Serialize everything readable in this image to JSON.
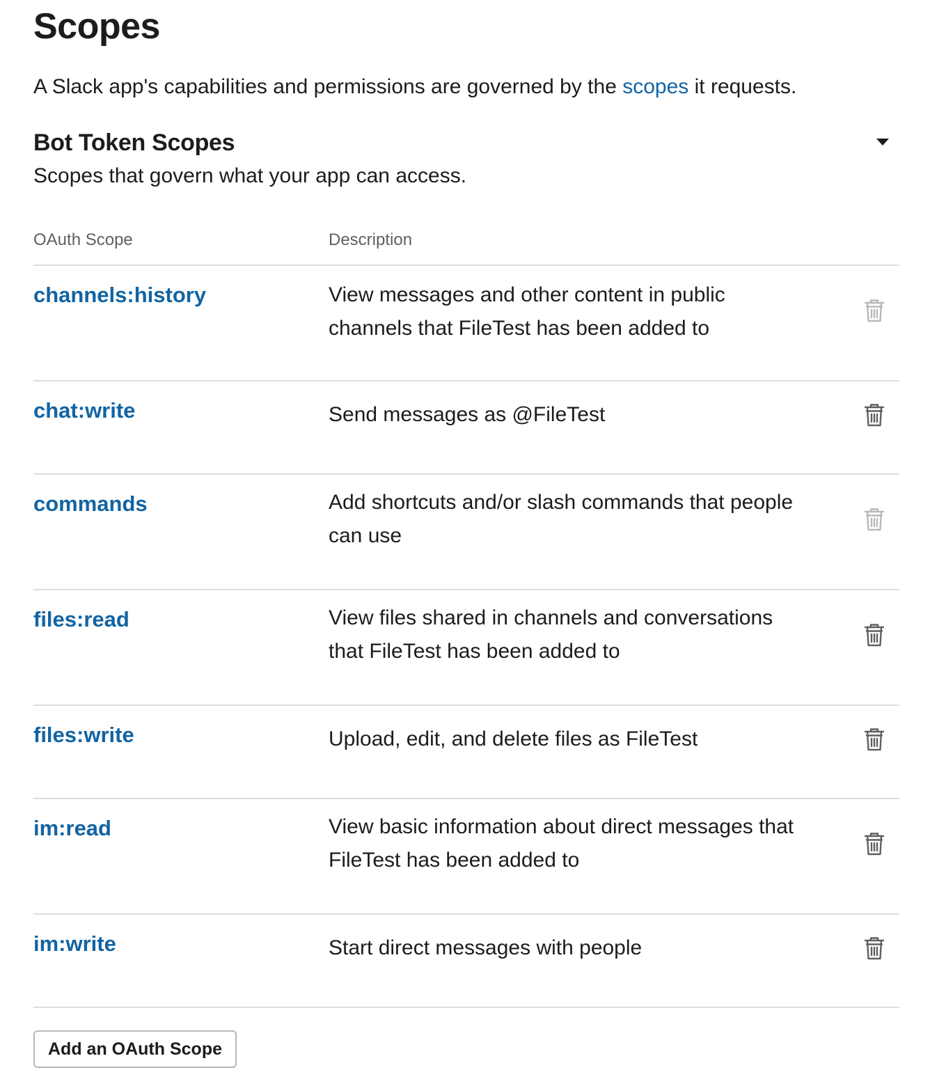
{
  "page": {
    "title": "Scopes",
    "intro_before": "A Slack app's capabilities and permissions are governed by the ",
    "intro_link": "scopes",
    "intro_after": " it requests."
  },
  "bot_token_scopes": {
    "title": "Bot Token Scopes",
    "description": "Scopes that govern what your app can access.",
    "collapse_icon": "caret-down-icon",
    "columns": {
      "scope": "OAuth Scope",
      "description": "Description"
    },
    "rows": [
      {
        "scope": "channels:history",
        "description": "View messages and other content in public channels that FileTest has been added to",
        "remove_enabled": false
      },
      {
        "scope": "chat:write",
        "description": "Send messages as @FileTest",
        "remove_enabled": true
      },
      {
        "scope": "commands",
        "description": "Add shortcuts and/or slash commands that people can use",
        "remove_enabled": false
      },
      {
        "scope": "files:read",
        "description": "View files shared in channels and conversations that FileTest has been added to",
        "remove_enabled": true
      },
      {
        "scope": "files:write",
        "description": "Upload, edit, and delete files as FileTest",
        "remove_enabled": true
      },
      {
        "scope": "im:read",
        "description": "View basic information about direct messages that FileTest has been added to",
        "remove_enabled": true
      },
      {
        "scope": "im:write",
        "description": "Start direct messages with people",
        "remove_enabled": true
      }
    ],
    "add_button_label": "Add an OAuth Scope"
  },
  "colors": {
    "link": "#1264a3",
    "icon_enabled": "#616061",
    "icon_disabled": "#b9b9b9",
    "divider": "#dddddd"
  }
}
